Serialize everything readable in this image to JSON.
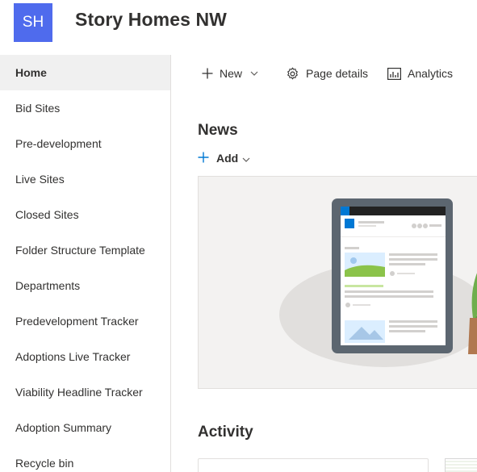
{
  "site": {
    "logo_initials": "SH",
    "logo_color": "#4f6bed",
    "title": "Story Homes NW"
  },
  "sidebar": {
    "items": [
      {
        "label": "Home",
        "active": true
      },
      {
        "label": "Bid Sites"
      },
      {
        "label": "Pre-development"
      },
      {
        "label": "Live Sites"
      },
      {
        "label": "Closed Sites"
      },
      {
        "label": "Folder Structure Template"
      },
      {
        "label": "Departments"
      },
      {
        "label": "Predevelopment Tracker"
      },
      {
        "label": "Adoptions Live Tracker"
      },
      {
        "label": "Viability Headline Tracker"
      },
      {
        "label": "Adoption Summary"
      },
      {
        "label": "Recycle bin"
      }
    ]
  },
  "commandbar": {
    "new_label": "New",
    "new_icon": "plus-icon",
    "page_details_label": "Page details",
    "page_details_icon": "gear-icon",
    "analytics_label": "Analytics",
    "analytics_icon": "analytics-icon"
  },
  "news": {
    "title": "News",
    "add_label": "Add"
  },
  "activity": {
    "title": "Activity"
  },
  "colors": {
    "accent": "#0078d4",
    "text": "#323130",
    "nav_active_bg": "#f0f0f0",
    "panel_bg": "#f3f2f1"
  }
}
